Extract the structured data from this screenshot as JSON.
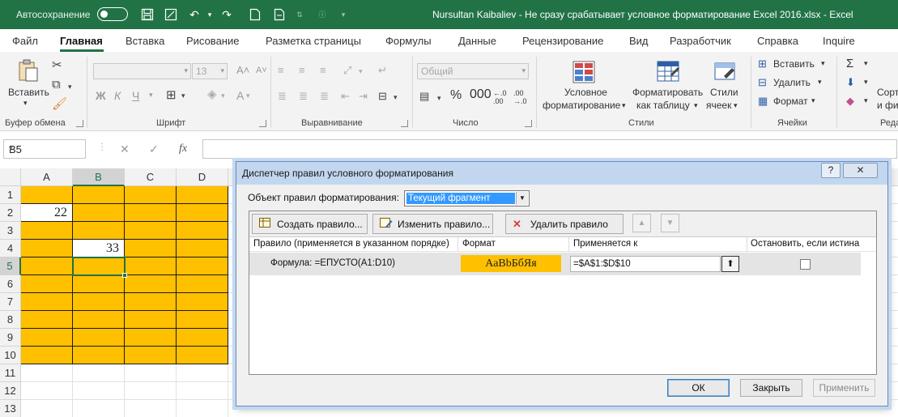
{
  "titlebar": {
    "autosave_label": "Автосохранение",
    "doc_title": "Nursultan Kaibaliev - Не сразу срабатывает условное форматирование Excel 2016.xlsx - Excel"
  },
  "tabs": [
    "Файл",
    "Главная",
    "Вставка",
    "Рисование",
    "Разметка страницы",
    "Формулы",
    "Данные",
    "Рецензирование",
    "Вид",
    "Разработчик",
    "Справка",
    "Inquire"
  ],
  "active_tab": "Главная",
  "ribbon": {
    "clipboard": {
      "label": "Буфер обмена",
      "paste": "Вставить"
    },
    "font": {
      "label": "Шрифт",
      "font_size": "13",
      "bold": "Ж",
      "italic": "К",
      "underline": "Ч"
    },
    "alignment": {
      "label": "Выравнивание"
    },
    "number": {
      "label": "Число",
      "format": "Общий"
    },
    "styles": {
      "label": "Стили",
      "cond_format_line1": "Условное",
      "cond_format_line2": "форматирование",
      "format_table_line1": "Форматировать",
      "format_table_line2": "как таблицу",
      "cell_styles_line1": "Стили",
      "cell_styles_line2": "ячеек"
    },
    "cells": {
      "label": "Ячейки",
      "insert": "Вставить",
      "delete": "Удалить",
      "format": "Формат"
    },
    "editing": {
      "label": "Реда",
      "sort_line1": "Сорт",
      "sort_line2": "и фи"
    }
  },
  "formula_bar": {
    "name_box": "B5",
    "fx": "fx"
  },
  "grid": {
    "columns": [
      "A",
      "B",
      "C",
      "D"
    ],
    "rows": [
      "1",
      "2",
      "3",
      "4",
      "5",
      "6",
      "7",
      "8",
      "9",
      "10",
      "11",
      "12",
      "13"
    ],
    "values": {
      "A2": "22",
      "B4": "33"
    },
    "fill_color": "#ffc000",
    "active_cell": "B5"
  },
  "dialog": {
    "title": "Диспетчер правил условного форматирования",
    "help": "?",
    "scope_label": "Объект правил форматирования:",
    "scope_value": "Текущий фрагмент",
    "buttons": {
      "new_rule": "Создать правило...",
      "edit_rule": "Изменить правило...",
      "delete_rule": "Удалить правило"
    },
    "headers": {
      "rule": "Правило (применяется в указанном порядке)",
      "format": "Формат",
      "applies_to": "Применяется к",
      "stop_if_true": "Остановить, если истина"
    },
    "rules": [
      {
        "formula": "Формула: =ЕПУСТО(A1:D10)",
        "preview": "АаBbБбЯя",
        "applies_to": "=$A$1:$D$10",
        "stop_if_true": false
      }
    ],
    "ok": "ОК",
    "close": "Закрыть",
    "apply": "Применить"
  }
}
